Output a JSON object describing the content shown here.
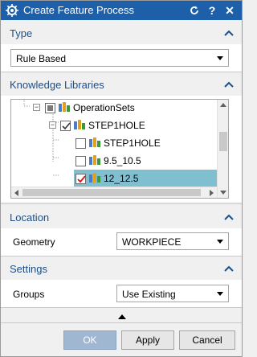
{
  "window": {
    "title": "Create Feature Process"
  },
  "sections": {
    "type": {
      "label": "Type",
      "dropdown_value": "Rule Based"
    },
    "knowledge_libraries": {
      "label": "Knowledge Libraries",
      "tree": [
        {
          "label": "OperationSets",
          "checkbox": "partial",
          "expanded": true,
          "selected": false
        },
        {
          "label": "STEP1HOLE",
          "checkbox": "checked",
          "expanded": true,
          "selected": false
        },
        {
          "label": "STEP1HOLE",
          "checkbox": "unchecked",
          "selected": false
        },
        {
          "label": "9.5_10.5",
          "checkbox": "unchecked",
          "selected": false
        },
        {
          "label": "12_12.5",
          "checkbox": "checked-red",
          "selected": true
        }
      ]
    },
    "location": {
      "label": "Location",
      "geometry_label": "Geometry",
      "geometry_value": "WORKPIECE"
    },
    "settings": {
      "label": "Settings",
      "groups_label": "Groups",
      "groups_value": "Use Existing"
    }
  },
  "buttons": {
    "ok": "OK",
    "apply": "Apply",
    "cancel": "Cancel"
  },
  "colors": {
    "titlebar": "#1d5fa9",
    "section_header_text": "#1a4f8b",
    "selection": "#7fbfcf",
    "ok_disabled": "#9fb7d1"
  }
}
